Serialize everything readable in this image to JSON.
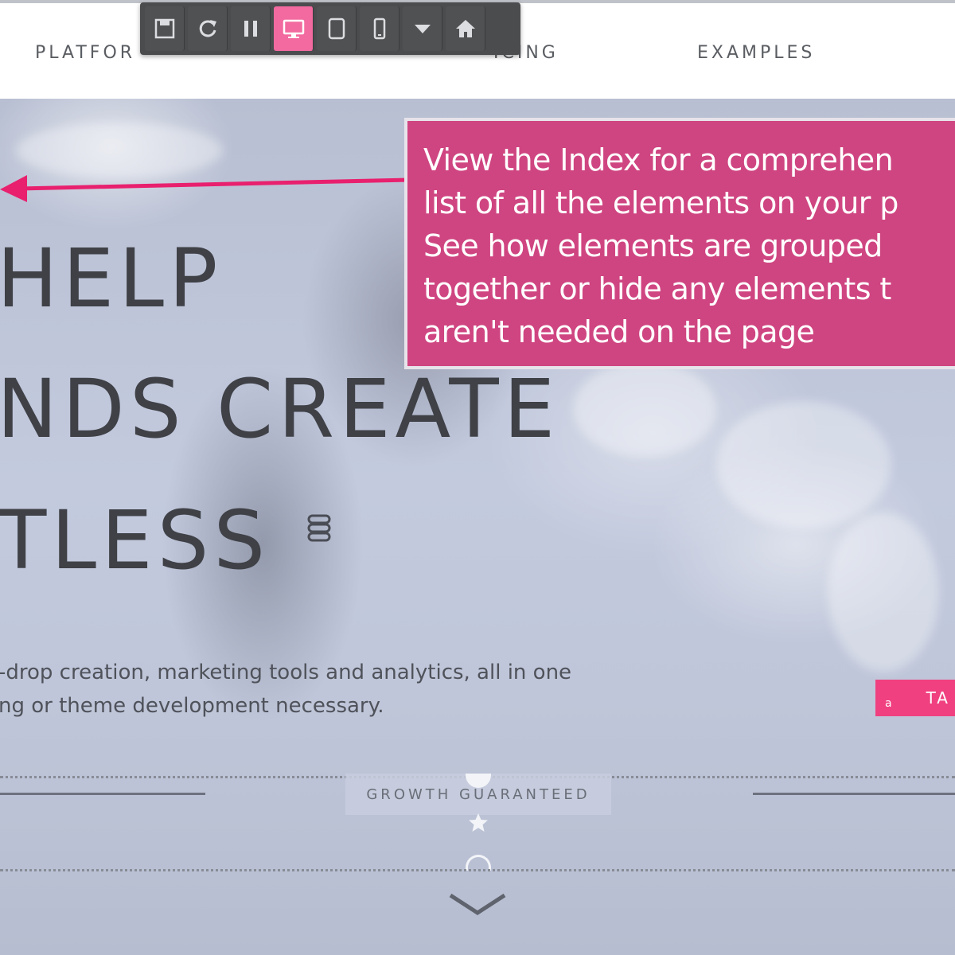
{
  "nav": {
    "platform": "PLATFOR",
    "pricing": "ICING",
    "examples": "EXAMPLES"
  },
  "toolbar": {
    "buttons": [
      {
        "icon": "save-icon"
      },
      {
        "icon": "refresh-icon"
      },
      {
        "icon": "pause-icon"
      },
      {
        "icon": "desktop-icon",
        "active": true
      },
      {
        "icon": "tablet-icon"
      },
      {
        "icon": "phone-icon"
      },
      {
        "icon": "dropdown-icon"
      },
      {
        "icon": "home-icon"
      }
    ],
    "active_color": "#f26a9f"
  },
  "hero": {
    "line1": "HELP",
    "line2": "NDS CREATE",
    "line3": "TLESS",
    "sub1": "-drop creation, marketing tools and analytics, all in one",
    "sub2": "ng or theme development necessary."
  },
  "tooltip": {
    "lines": [
      "View the Index for a comprehen",
      "list of all the elements on your p",
      "See how elements are grouped",
      "together or hide any elements t",
      "aren't needed on the page"
    ],
    "color": "#cf4581"
  },
  "cta": {
    "label": "TA",
    "small": "a"
  },
  "band": {
    "growth": "GROWTH GUARANTEED"
  }
}
